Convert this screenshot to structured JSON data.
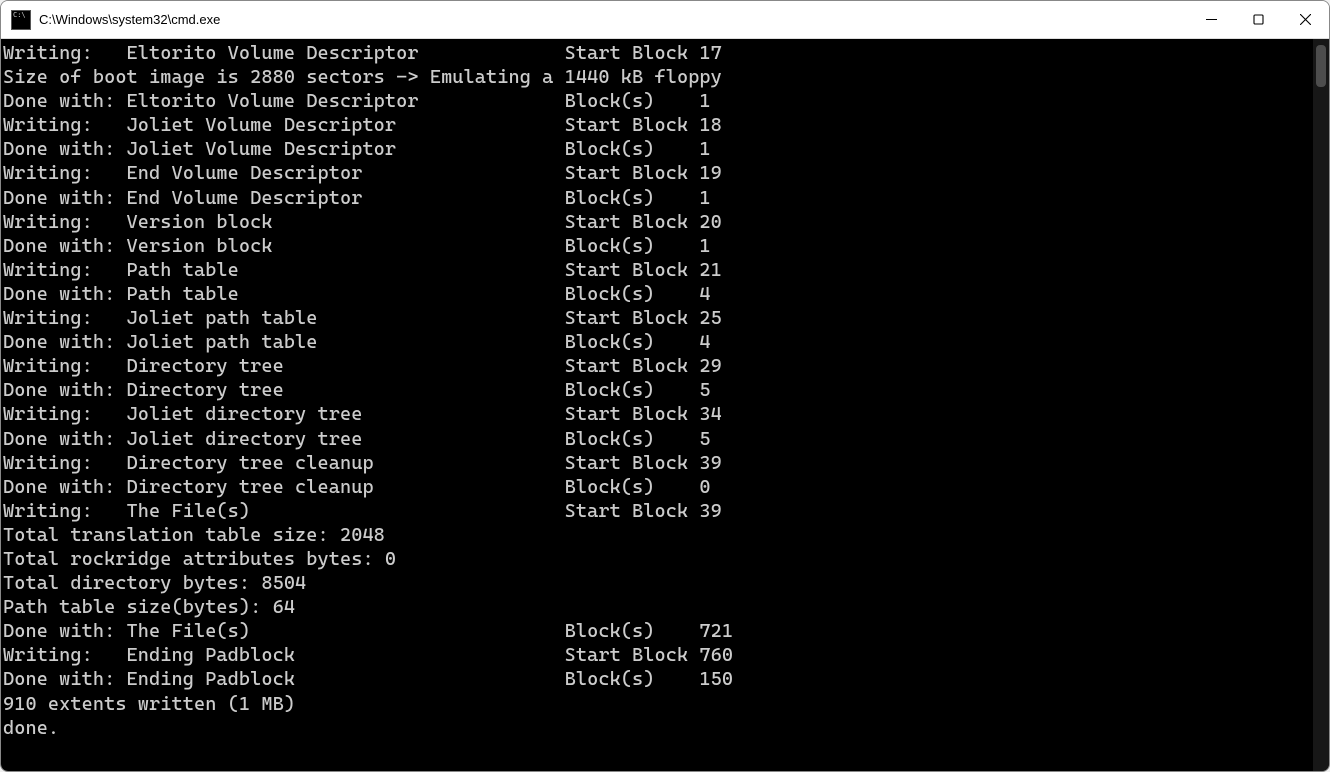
{
  "window": {
    "title": "C:\\Windows\\system32\\cmd.exe"
  },
  "terminal": {
    "lines": [
      "Writing:   Eltorito Volume Descriptor             Start Block 17",
      "Size of boot image is 2880 sectors -> Emulating a 1440 kB floppy",
      "Done with: Eltorito Volume Descriptor             Block(s)    1",
      "Writing:   Joliet Volume Descriptor               Start Block 18",
      "Done with: Joliet Volume Descriptor               Block(s)    1",
      "Writing:   End Volume Descriptor                  Start Block 19",
      "Done with: End Volume Descriptor                  Block(s)    1",
      "Writing:   Version block                          Start Block 20",
      "Done with: Version block                          Block(s)    1",
      "Writing:   Path table                             Start Block 21",
      "Done with: Path table                             Block(s)    4",
      "Writing:   Joliet path table                      Start Block 25",
      "Done with: Joliet path table                      Block(s)    4",
      "Writing:   Directory tree                         Start Block 29",
      "Done with: Directory tree                         Block(s)    5",
      "Writing:   Joliet directory tree                  Start Block 34",
      "Done with: Joliet directory tree                  Block(s)    5",
      "Writing:   Directory tree cleanup                 Start Block 39",
      "Done with: Directory tree cleanup                 Block(s)    0",
      "Writing:   The File(s)                            Start Block 39",
      "Total translation table size: 2048",
      "Total rockridge attributes bytes: 0",
      "Total directory bytes: 8504",
      "Path table size(bytes): 64",
      "Done with: The File(s)                            Block(s)    721",
      "Writing:   Ending Padblock                        Start Block 760",
      "Done with: Ending Padblock                        Block(s)    150",
      "910 extents written (1 MB)",
      "done."
    ]
  }
}
